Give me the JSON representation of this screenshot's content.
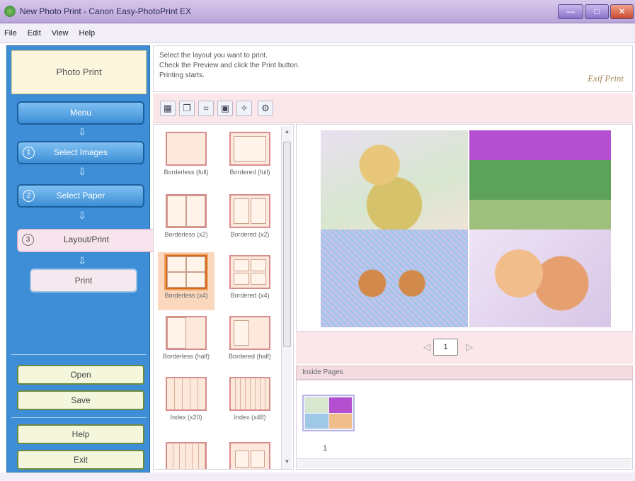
{
  "window": {
    "title": "New Photo Print - Canon Easy-PhotoPrint EX",
    "buttons": {
      "minimize": "—",
      "maximize": "□",
      "close": "✕"
    }
  },
  "menu": [
    "File",
    "Edit",
    "View",
    "Help"
  ],
  "sidebar": {
    "header": "Photo Print",
    "steps": [
      {
        "label": "Menu",
        "number": ""
      },
      {
        "label": "Select Images",
        "number": "1"
      },
      {
        "label": "Select Paper",
        "number": "2"
      },
      {
        "label": "Layout/Print",
        "number": "3"
      }
    ],
    "print_label": "Print",
    "open_label": "Open",
    "save_label": "Save",
    "help_label": "Help",
    "exit_label": "Exit"
  },
  "instructions": {
    "line1": "Select the layout you want to print.",
    "line2": "Check the Preview and click the Print button.",
    "line3": "Printing starts.",
    "exif": "Exif Print"
  },
  "toolbar": {
    "icons": [
      "layout-icon",
      "copy-icon",
      "crop-icon",
      "image-icon",
      "effects-icon",
      "settings-icon"
    ]
  },
  "layouts": [
    {
      "label": "Borderless (full)",
      "selected": false
    },
    {
      "label": "Bordered (full)",
      "selected": false
    },
    {
      "label": "Borderless (x2)",
      "selected": false
    },
    {
      "label": "Bordered (x2)",
      "selected": false
    },
    {
      "label": "Borderless (x4)",
      "selected": true
    },
    {
      "label": "Bordered (x4)",
      "selected": false
    },
    {
      "label": "Borderless (half)",
      "selected": false
    },
    {
      "label": "Bordered (half)",
      "selected": false
    },
    {
      "label": "Index (x20)",
      "selected": false
    },
    {
      "label": "Index (x48)",
      "selected": false
    }
  ],
  "pager": {
    "page": "1",
    "prev": "◁",
    "next": "▷"
  },
  "inside_pages": {
    "header": "Inside Pages",
    "page_number": "1"
  },
  "colors": {
    "sidebar": "#3d8ed6",
    "accent": "#fbe7ea",
    "selected": "#fbd7be"
  }
}
